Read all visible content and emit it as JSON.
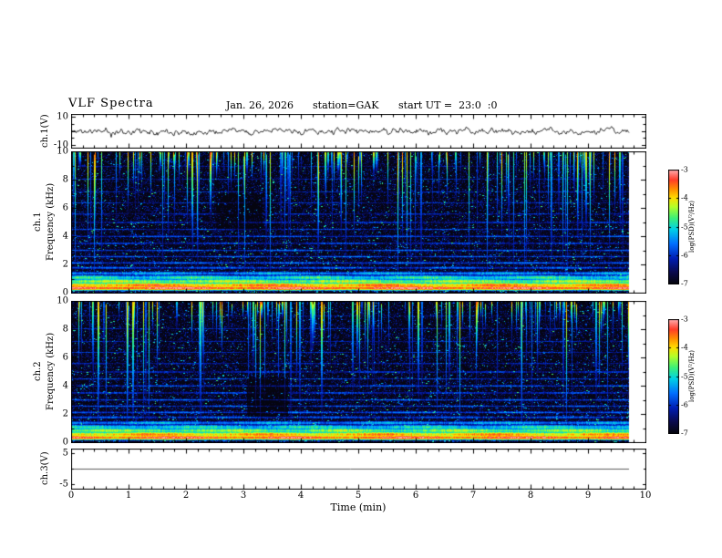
{
  "header": {
    "title": "VLF Spectra",
    "date": "Jan. 26, 2026",
    "station": "station=GAK",
    "start_ut": "start UT =  23:0  :0"
  },
  "axes": {
    "time": {
      "label": "Time  (min)",
      "ticks": [
        0,
        1,
        2,
        3,
        4,
        5,
        6,
        7,
        8,
        9,
        10
      ],
      "range": [
        0,
        10
      ],
      "data_end_min": 9.71
    },
    "colorbar": {
      "label": "log(PSD)(V²/Hz)",
      "ticks": [
        -3,
        -4,
        -5,
        -6,
        -7
      ],
      "range": [
        -7,
        -3
      ],
      "colormap_stops": [
        {
          "t": 0.0,
          "color": "#050510"
        },
        {
          "t": 0.1,
          "color": "#0a0a50"
        },
        {
          "t": 0.22,
          "color": "#001eb4"
        },
        {
          "t": 0.35,
          "color": "#006eff"
        },
        {
          "t": 0.48,
          "color": "#00d2e6"
        },
        {
          "t": 0.58,
          "color": "#3cf078"
        },
        {
          "t": 0.68,
          "color": "#b4ff28"
        },
        {
          "t": 0.76,
          "color": "#ffdc00"
        },
        {
          "t": 0.84,
          "color": "#ff8c00"
        },
        {
          "t": 0.92,
          "color": "#ff3c28"
        },
        {
          "t": 1.0,
          "color": "#ffa0a0"
        }
      ]
    }
  },
  "chart_data": [
    {
      "type": "line",
      "name": "ch1_waveform",
      "ylabel": "ch.1(V)",
      "xlim": [
        0,
        10
      ],
      "ylim": [
        -10,
        10
      ],
      "yticks": [
        10,
        -10
      ],
      "data_end_min": 9.71,
      "baseline_v": 0,
      "noise_amplitude_v": 1.3,
      "spike_rate": 0.008,
      "line_color": "#000000",
      "seed": 11
    },
    {
      "type": "heatmap",
      "name": "ch1_spectrogram",
      "channel": "ch.1",
      "ylabel": "Frequency (kHz)",
      "xlim": [
        0,
        10
      ],
      "ylim": [
        0,
        10
      ],
      "yticks": [
        0,
        2,
        4,
        6,
        8,
        10
      ],
      "zlabel": "log(PSD)(V²/Hz)",
      "zlim": [
        -7,
        -3
      ],
      "background_psd": -7,
      "bands": [
        {
          "f": 0.3,
          "psd": -3.2,
          "w": 0.1
        },
        {
          "f": 0.5,
          "psd": -3.7,
          "w": 0.12
        },
        {
          "f": 0.78,
          "psd": -4.4,
          "w": 0.12
        },
        {
          "f": 1.05,
          "psd": -4.9,
          "w": 0.12
        },
        {
          "f": 1.35,
          "psd": -5.4,
          "w": 0.1
        },
        {
          "f": 1.75,
          "psd": -5.9,
          "w": 0.08
        },
        {
          "f": 2.1,
          "psd": -5.8,
          "w": 0.07
        },
        {
          "f": 2.55,
          "psd": -5.9,
          "w": 0.06
        },
        {
          "f": 3.0,
          "psd": -5.85,
          "w": 0.06
        },
        {
          "f": 3.5,
          "psd": -6.0,
          "w": 0.06
        },
        {
          "f": 4.0,
          "psd": -5.9,
          "w": 0.06
        },
        {
          "f": 4.5,
          "psd": -6.05,
          "w": 0.05
        },
        {
          "f": 5.0,
          "psd": -6.0,
          "w": 0.05
        },
        {
          "f": 5.6,
          "psd": -6.2,
          "w": 0.05
        },
        {
          "f": 6.4,
          "psd": -6.2,
          "w": 0.05
        },
        {
          "f": 7.2,
          "psd": -6.3,
          "w": 0.05
        },
        {
          "f": 8.1,
          "psd": -6.3,
          "w": 0.04
        },
        {
          "f": 9.0,
          "psd": -6.35,
          "w": 0.04
        }
      ],
      "vertical_streaks": {
        "count": 170,
        "peak_psd_range": [
          -5.8,
          -3.4
        ],
        "extent_khz_range": [
          1.2,
          10
        ]
      },
      "tall_streaks": 7,
      "speckle": {
        "count": 3200,
        "psd_range": [
          -6.4,
          -4.6
        ]
      },
      "dark_patches": [
        {
          "t0": 2.5,
          "t1": 3.3,
          "f0": 4.5,
          "f1": 7.0,
          "amount": 0.4
        }
      ],
      "seed": 21
    },
    {
      "type": "heatmap",
      "name": "ch2_spectrogram",
      "channel": "ch.2",
      "ylabel": "Frequency (kHz)",
      "xlim": [
        0,
        10
      ],
      "ylim": [
        0,
        10
      ],
      "yticks": [
        0,
        2,
        4,
        6,
        8,
        10
      ],
      "zlabel": "log(PSD)(V²/Hz)",
      "zlim": [
        -7,
        -3
      ],
      "background_psd": -7,
      "bands": [
        {
          "f": 0.3,
          "psd": -3.3,
          "w": 0.1
        },
        {
          "f": 0.52,
          "psd": -3.8,
          "w": 0.12
        },
        {
          "f": 0.8,
          "psd": -4.5,
          "w": 0.12
        },
        {
          "f": 1.05,
          "psd": -5.0,
          "w": 0.12
        },
        {
          "f": 1.35,
          "psd": -5.4,
          "w": 0.1
        },
        {
          "f": 1.75,
          "psd": -5.9,
          "w": 0.08
        },
        {
          "f": 2.1,
          "psd": -5.8,
          "w": 0.07
        },
        {
          "f": 2.55,
          "psd": -5.9,
          "w": 0.06
        },
        {
          "f": 3.0,
          "psd": -5.85,
          "w": 0.06
        },
        {
          "f": 3.5,
          "psd": -6.0,
          "w": 0.06
        },
        {
          "f": 4.0,
          "psd": -5.9,
          "w": 0.06
        },
        {
          "f": 4.5,
          "psd": -6.05,
          "w": 0.05
        },
        {
          "f": 5.0,
          "psd": -6.0,
          "w": 0.05
        },
        {
          "f": 5.6,
          "psd": -6.2,
          "w": 0.05
        },
        {
          "f": 6.4,
          "psd": -6.2,
          "w": 0.05
        },
        {
          "f": 7.2,
          "psd": -6.3,
          "w": 0.05
        },
        {
          "f": 8.1,
          "psd": -6.3,
          "w": 0.04
        },
        {
          "f": 9.0,
          "psd": -6.35,
          "w": 0.04
        }
      ],
      "vertical_streaks": {
        "count": 170,
        "peak_psd_range": [
          -5.8,
          -3.4
        ],
        "extent_khz_range": [
          1.2,
          10
        ]
      },
      "tall_streaks": 7,
      "speckle": {
        "count": 3200,
        "psd_range": [
          -6.4,
          -4.6
        ]
      },
      "dark_patches": [
        {
          "t0": 3.05,
          "t1": 3.75,
          "f0": 1.8,
          "f1": 4.6,
          "amount": 0.6
        }
      ],
      "seed": 37
    },
    {
      "type": "line",
      "name": "ch3_waveform",
      "ylabel": "ch.3(V)",
      "xlim": [
        0,
        10
      ],
      "ylim": [
        -6.5,
        6.5
      ],
      "yticks": [
        5,
        -5
      ],
      "data_end_min": 9.71,
      "baseline_v": 0,
      "noise_amplitude_v": 0,
      "spike_rate": 0,
      "line_color": "#333333",
      "seed": 13
    }
  ]
}
